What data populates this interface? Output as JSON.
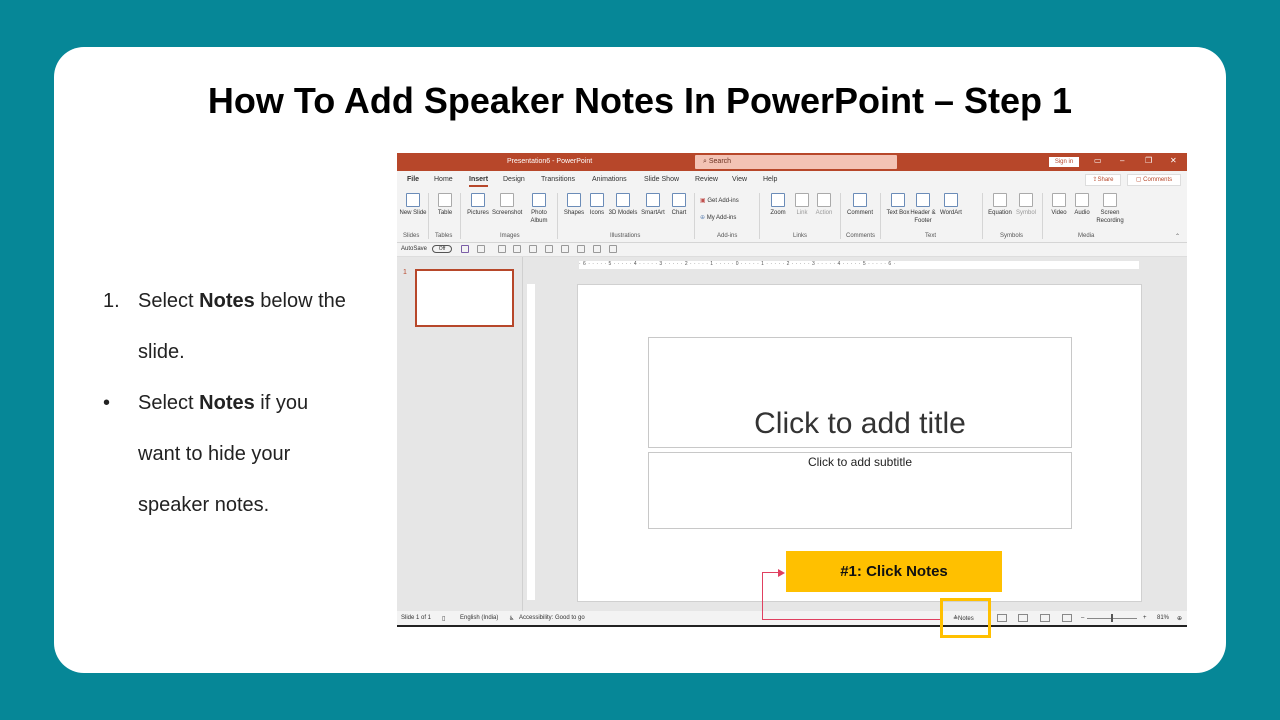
{
  "slide": {
    "title": "How To Add Speaker Notes In PowerPoint – Step 1",
    "steps": [
      {
        "marker": "1.",
        "pre": "Select ",
        "bold": "Notes",
        "post": " below the slide."
      },
      {
        "marker": "•",
        "pre": "Select ",
        "bold": "Notes",
        "post": " if you want to hide your speaker notes."
      }
    ],
    "callout": "#1: Click Notes"
  },
  "ppt": {
    "doc_title": "Presentation6  -  PowerPoint",
    "search_placeholder": "Search",
    "sign_in": "Sign in",
    "tabs": [
      "File",
      "Home",
      "Insert",
      "Design",
      "Transitions",
      "Animations",
      "Slide Show",
      "Review",
      "View",
      "Help"
    ],
    "active_tab": "Insert",
    "share": "Share",
    "comments": "Comments",
    "ribbon": {
      "new_slide": "New Slide",
      "table": "Table",
      "pictures": "Pictures",
      "screenshot": "Screenshot",
      "photo_album": "Photo Album",
      "shapes": "Shapes",
      "icons": "Icons",
      "models_3d": "3D Models",
      "smartart": "SmartArt",
      "chart": "Chart",
      "get_addins": "Get Add-ins",
      "my_addins": "My Add-ins",
      "zoom": "Zoom",
      "link": "Link",
      "action": "Action",
      "comment": "Comment",
      "text_box": "Text Box",
      "header_footer": "Header & Footer",
      "wordart": "WordArt",
      "equation": "Equation",
      "symbol": "Symbol",
      "video": "Video",
      "audio": "Audio",
      "screen_recording": "Screen Recording"
    },
    "groups": [
      "Slides",
      "Tables",
      "Images",
      "Illustrations",
      "Add-ins",
      "Links",
      "Comments",
      "Text",
      "Symbols",
      "Media"
    ],
    "autosave": "AutoSave",
    "autosave_state": "Off",
    "ruler": "· 6 · · · · · 5 · · · · · 4 · · · · · 3 · · · · · 2 · · · · · 1 · · · · · 0 · · · · · 1 · · · · · 2 · · · · · 3 · · · · · 4 · · · · · 5 · · · · · 6 ·",
    "thumb_number": "1",
    "title_placeholder": "Click to add title",
    "subtitle_placeholder": "Click to add subtitle",
    "status": {
      "slide_count": "Slide 1 of 1",
      "language": "English (India)",
      "accessibility": "Accessibility: Good to go",
      "notes": "Notes",
      "zoom": "81%"
    }
  }
}
